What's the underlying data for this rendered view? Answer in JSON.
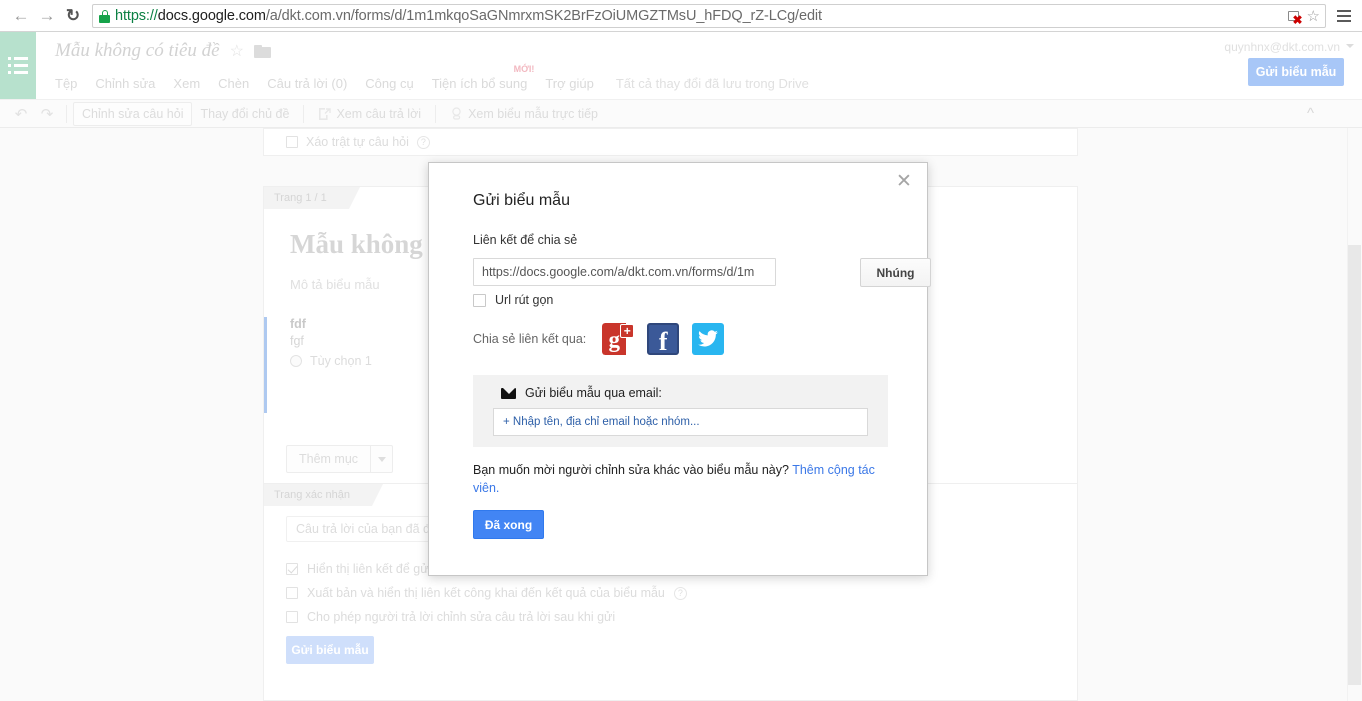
{
  "browser": {
    "back_icon": "back-arrow-icon",
    "forward_icon": "forward-arrow-icon",
    "reload_icon": "reload-icon",
    "url_scheme": "https://",
    "url_host": "docs.google.com",
    "url_path": "/a/dkt.com.vn/forms/d/1m1mkqoSaGNmrxmSK2BrFzOiUMGZTMsU_hFDQ_rZ-LCg/edit",
    "full_url": "https://docs.google.com/a/dkt.com.vn/forms/d/1m1mkqoSaGNmrxmSK2BrFzOiUMGZTMsU_hFDQ_rZ-LCg/edit",
    "lock_icon": "secure-lock-icon",
    "blocked_icon": "blocked-content-icon",
    "bookmark_icon": "star-icon",
    "menu_icon": "hamburger-menu-icon"
  },
  "header": {
    "apps_icon": "forms-list-icon",
    "doc_title": "Mẫu không có tiêu đề",
    "star_icon": "star-icon",
    "folder_icon": "folder-icon",
    "account_email": "quynhnx@dkt.com.vn",
    "send_form_label": "Gửi biểu mẫu",
    "accent_green": "#b7e1cd",
    "accent_blue": "#4285f4",
    "menus": [
      {
        "label": "Tệp"
      },
      {
        "label": "Chỉnh sửa"
      },
      {
        "label": "Xem"
      },
      {
        "label": "Chèn"
      },
      {
        "label": "Câu trả lời (0)"
      },
      {
        "label": "Công cụ"
      },
      {
        "label": "Tiện ích bổ sung",
        "badge": "MỚI!"
      },
      {
        "label": "Trợ giúp"
      }
    ],
    "drive_status": "Tất cả thay đổi đã lưu trong Drive"
  },
  "toolbar": {
    "undo_icon": "undo-icon",
    "redo_icon": "redo-icon",
    "edit_questions": "Chỉnh sửa câu hỏi",
    "change_theme": "Thay đổi chủ đề",
    "view_responses": "Xem câu trả lời",
    "view_live_form": "Xem biểu mẫu trực tiếp",
    "view_responses_icon": "external-link-icon",
    "view_live_icon": "globe-link-icon",
    "collapse_icon": "collapse-chevron-up-icon"
  },
  "canvas": {
    "shuffle_label": "Xáo trật tự câu hỏi",
    "shuffle_help": "?",
    "page_tab": "Trang 1 / 1",
    "form_title": "Mẫu không có tiêu đề",
    "form_description": "Mô tả biểu mẫu",
    "question_title": "fdf",
    "question_subtitle": "fgf",
    "question_option": "Tùy chọn 1",
    "add_item_label": "Thêm mục",
    "confirm_tab": "Trang xác nhận",
    "confirm_message": "Câu trả lời của bạn đã đ",
    "confirm_options": [
      {
        "label": "Hiển thị liên kết để gử",
        "checked": true
      },
      {
        "label": "Xuất bản và hiển thị liên kết công khai đến kết quả của biểu mẫu",
        "checked": false,
        "help": "?"
      },
      {
        "label": "Cho phép người trả lời chỉnh sửa câu trả lời sau khi gửi",
        "checked": false
      }
    ],
    "send_form_ghost": "Gửi biểu mẫu"
  },
  "modal": {
    "title": "Gửi biểu mẫu",
    "close_icon": "close-icon",
    "link_label": "Liên kết để chia sẻ",
    "link_value": "https://docs.google.com/a/dkt.com.vn/forms/d/1m",
    "embed_button": "Nhúng",
    "short_url_label": "Url rút gọn",
    "short_url_checked": false,
    "share_via_label": "Chia sẻ liên kết qua:",
    "social": [
      {
        "name": "google-plus-share-icon",
        "glyph": "g",
        "plus": "+",
        "color": "#c9352b"
      },
      {
        "name": "facebook-share-icon",
        "glyph": "f",
        "color": "#3b5998"
      },
      {
        "name": "twitter-share-icon",
        "glyph": "bird",
        "color": "#29b6f0"
      }
    ],
    "email_section_label": "Gửi biểu mẫu qua email:",
    "email_icon": "envelope-icon",
    "email_placeholder": "+ Nhập tên, địa chỉ email hoặc nhóm...",
    "collab_text": "Bạn muốn mời người chỉnh sửa khác vào biểu mẫu này? ",
    "collab_link": "Thêm cộng tác viên.",
    "done_button": "Đã xong"
  }
}
